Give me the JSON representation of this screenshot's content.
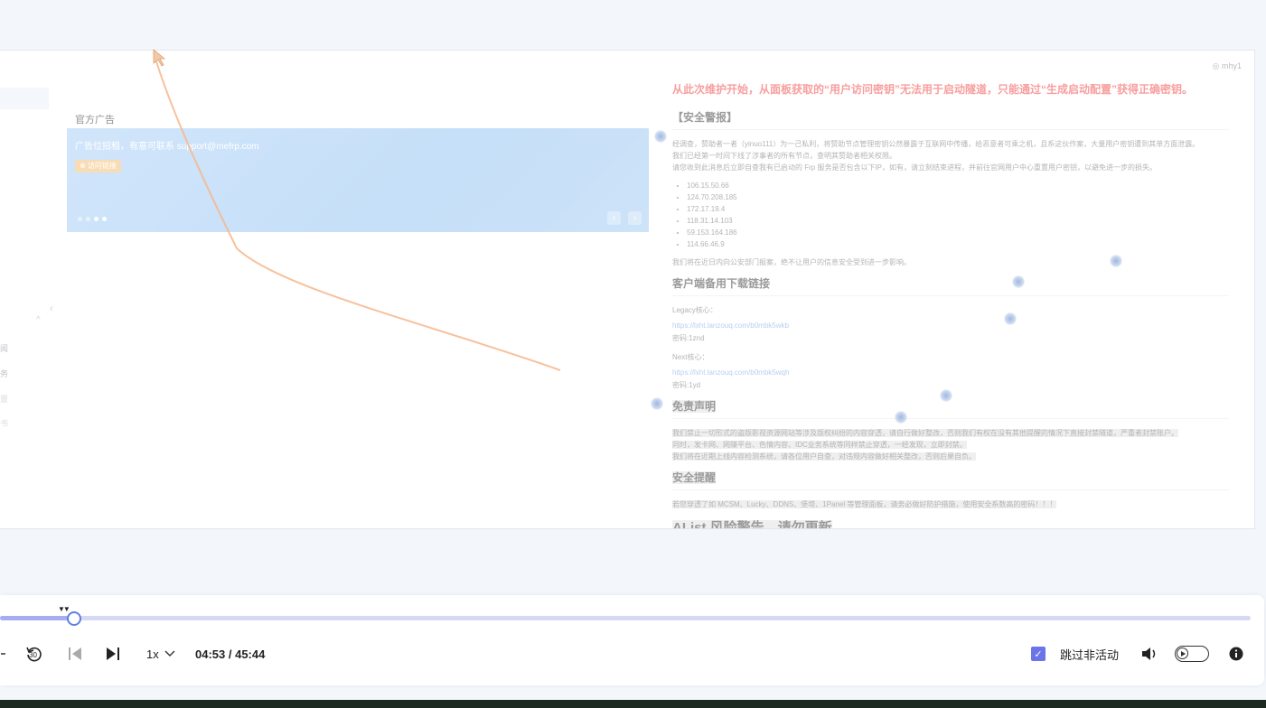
{
  "user": {
    "name": "mhy1"
  },
  "ad": {
    "title": "官方广告",
    "banner_text": "广告位招租，有意可联系 support@mefrp.com",
    "button": "访问链接",
    "prev": "‹",
    "next": "›"
  },
  "notice": {
    "warning": "从此次维护开始，从面板获取的“用户访问密钥”无法用于启动隧道，只能通过“生成启动配置”获得正确密钥。",
    "security_title": "【安全警报】",
    "security_p1": "经调查，赞助者一者（yinuo111）为一己私利，将赞助节点管理密钥公然暴露于互联网中传播，给恶意者可乘之机，且系这伙作案，大量用户密钥遭到其单方面泄露。",
    "security_p2": "我们已经第一时间下线了涉事者的所有节点，查明其赞助者相关权限。",
    "security_p3": "请您收到此消息后立即自查我有已启动的 Frp 服务是否包含以下IP，如有，请立刻结束进程，并前往官网用户中心重置用户密钥，以避免进一步的损失。",
    "ips": [
      "106.15.50.66",
      "124.70.208.185",
      "172.17.19.4",
      "118.31.14.103",
      "59.153.164.186",
      "114.66.46.9"
    ],
    "security_p4": "我们将在近日内向公安部门报案，绝不让用户的信息安全受到进一步影响。",
    "download_title": "客户端备用下载链接",
    "legacy_label": "Legacy核心：",
    "legacy_link": "https://lxht.lanzouq.com/b0mbk5wkb",
    "legacy_pwd": "密码:1znd",
    "next_label": "Next核心：",
    "next_link": "https://lxht.lanzouq.com/b0mbk5wqh",
    "next_pwd": "密码:1yd",
    "disclaimer_title": "免责声明",
    "disclaimer_p1": "我们禁止一切形式的盗版影视资源网站等涉及版权纠纷的内容穿透，请自行做好整改，否则我们有权在没有其他提醒的情况下直接封禁隧道，严重者封禁账户。",
    "disclaimer_p2": "同时，发卡网、网赚平台、色情内容、IDC业务系统等同样禁止穿透，一经发现，立即封禁。",
    "disclaimer_p3": "我们将在近期上线内容检测系统，请各位用户自查，对违规内容做好相关整改，否则后果自负。",
    "safety_title": "安全提醒",
    "safety_p1": "若您穿透了如 MCSM、Lucky、DDNS、堡塔、1Panel 等管理面板，请务必做好防护措施，使用安全系数高的密码！！！",
    "alist_title": "AList 风险警告，请勿更新"
  },
  "sidebar_fragments": [
    "阅",
    "务",
    "置",
    "书"
  ],
  "player": {
    "progress": 0.06,
    "speed": "1x",
    "time": "04:53 / 45:44",
    "skip_inactive_label": "跳过非活动",
    "skip_inactive_checked": true,
    "rewind_label": "30"
  },
  "colors": {
    "accent": "#6b74e8",
    "warning": "#f46a6a",
    "track": "#d6d8f6"
  }
}
